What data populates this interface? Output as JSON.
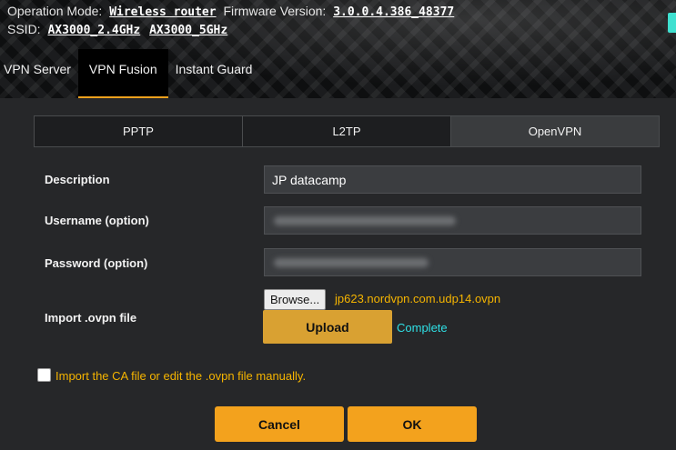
{
  "header": {
    "operation_mode_label": "Operation Mode:",
    "operation_mode_value": "Wireless router",
    "firmware_label": "Firmware Version:",
    "firmware_value": "3.0.0.4.386_48377",
    "ssid_label": "SSID:",
    "ssid_24": "AX3000_2.4GHz",
    "ssid_5": "AX3000_5GHz"
  },
  "tabs": [
    {
      "label": "VPN Server"
    },
    {
      "label": "VPN Fusion"
    },
    {
      "label": "Instant Guard"
    }
  ],
  "protocols": [
    {
      "label": "PPTP"
    },
    {
      "label": "L2TP"
    },
    {
      "label": "OpenVPN"
    }
  ],
  "form": {
    "description_label": "Description",
    "description_value": "JP datacamp",
    "username_label": "Username (option)",
    "password_label": "Password (option)",
    "import_label": "Import .ovpn file",
    "browse_label": "Browse...",
    "filename": "jp623.nordvpn.com.udp14.ovpn",
    "upload_label": "Upload",
    "upload_status": "Complete",
    "manual_label": "Import the CA file or edit the .ovpn file manually."
  },
  "actions": {
    "cancel_label": "Cancel",
    "ok_label": "OK"
  },
  "colors": {
    "accent": "#f3a21d",
    "status": "#2fe0e6",
    "hint": "#f5b400"
  }
}
